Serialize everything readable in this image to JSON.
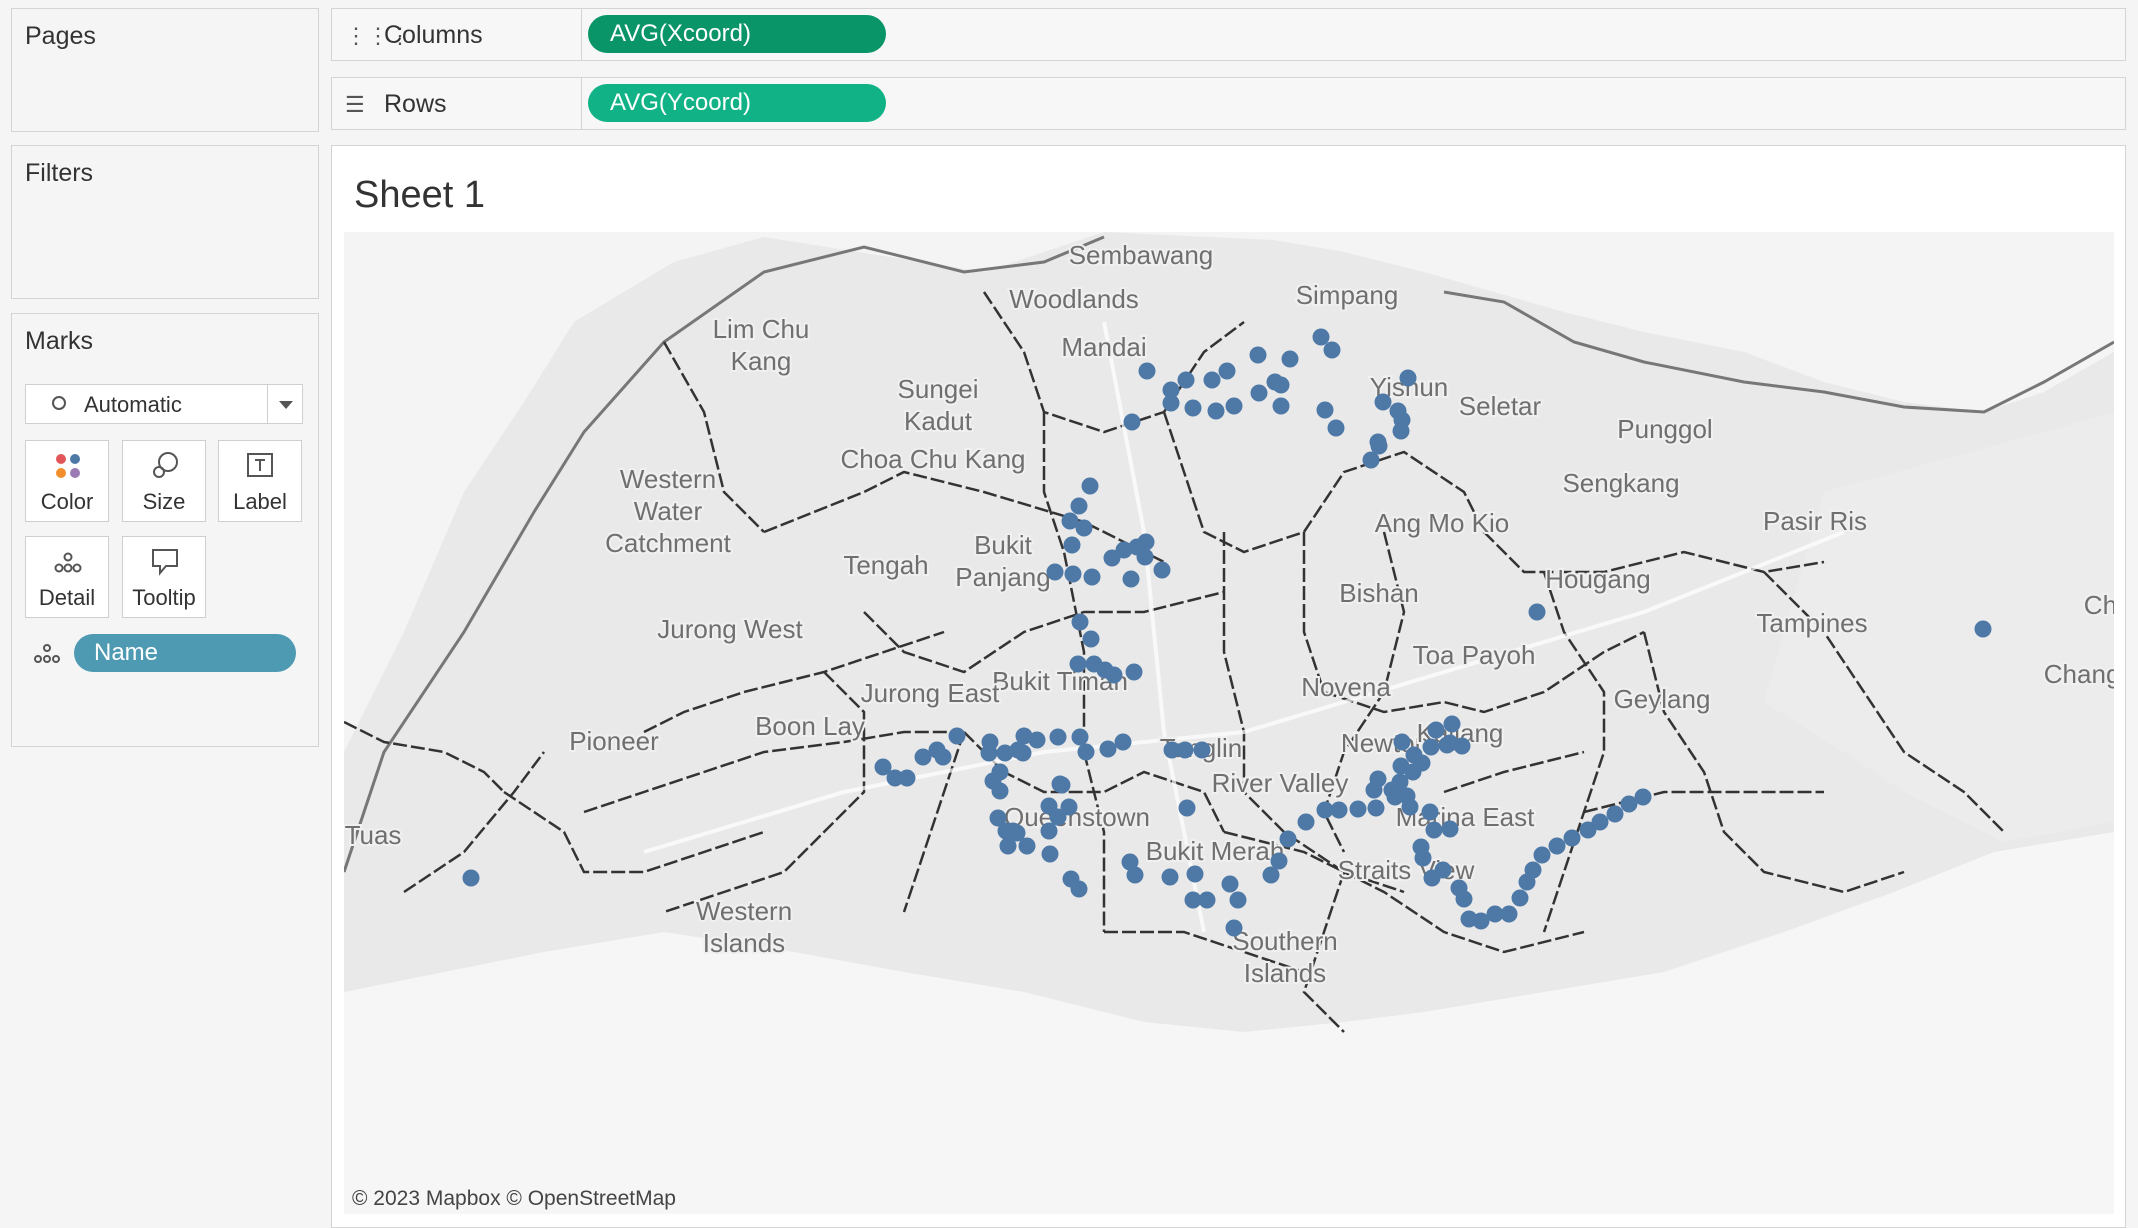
{
  "pages_title": "Pages",
  "filters_title": "Filters",
  "marks": {
    "title": "Marks",
    "mark_type": "Automatic",
    "buttons": {
      "color": "Color",
      "size": "Size",
      "label": "Label",
      "detail": "Detail",
      "tooltip": "Tooltip"
    },
    "detail_pill": "Name"
  },
  "columns": {
    "label": "Columns",
    "pill": "AVG(Xcoord)",
    "pill_color": "#0a9568"
  },
  "rows": {
    "label": "Rows",
    "pill": "AVG(Ycoord)",
    "pill_color": "#11b386"
  },
  "sheet_title": "Sheet 1",
  "attribution": "© 2023 Mapbox © OpenStreetMap",
  "mark_color": "#4e79a7",
  "map_places": [
    "Sembawang",
    "Simpang",
    "Lim Chu Kang",
    "Woodlands",
    "Mandai",
    "Sungei Kadut",
    "Yishun",
    "Seletar",
    "Punggol",
    "Western Water Catchment",
    "Choa Chu Kang",
    "Sengkang",
    "Pasir Ris",
    "Ang Mo Kio",
    "Bukit Panjang",
    "Tengah",
    "Hougang",
    "Bishan",
    "Changi",
    "Jurong West",
    "Tampines",
    "Toa Payoh",
    "Bukit Timah",
    "Jurong East",
    "Novena",
    "Geylang",
    "Boon Lay",
    "Pioneer",
    "Tanglin",
    "Newton",
    "Kallang",
    "River Valley",
    "Queenstown",
    "Marina East",
    "Tuas",
    "Bukit Merah",
    "Straits View",
    "Western Islands",
    "Southern Islands",
    "Changi Bay"
  ]
}
